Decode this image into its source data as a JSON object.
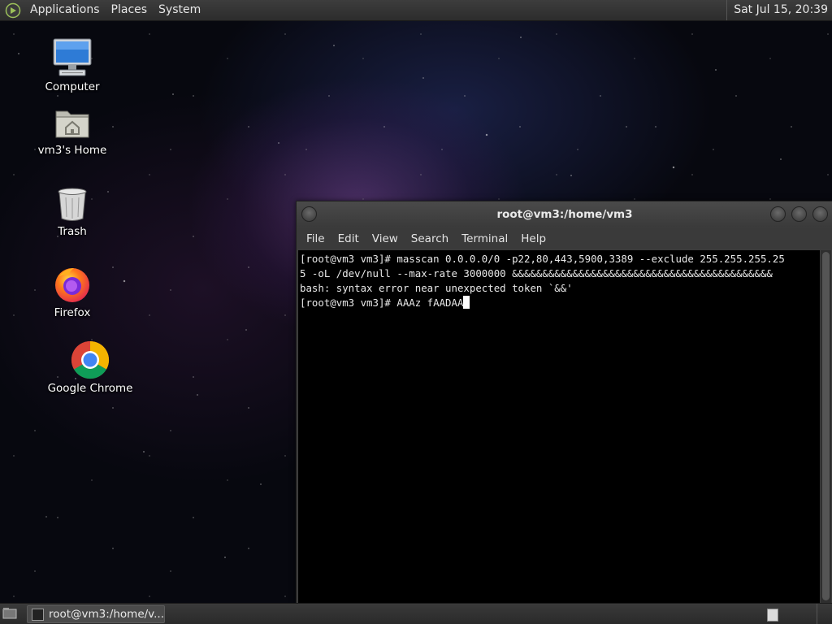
{
  "top_panel": {
    "menus": [
      "Applications",
      "Places",
      "System"
    ],
    "clock": "Sat Jul 15, 20:39"
  },
  "desktop_icons": [
    {
      "label": "Computer",
      "icon": "computer-icon"
    },
    {
      "label": "vm3's Home",
      "icon": "home-folder-icon"
    },
    {
      "label": "Trash",
      "icon": "trash-icon"
    },
    {
      "label": "Firefox",
      "icon": "firefox-icon"
    },
    {
      "label": "Google Chrome",
      "icon": "chrome-icon"
    }
  ],
  "terminal": {
    "title": "root@vm3:/home/vm3",
    "menu": [
      "File",
      "Edit",
      "View",
      "Search",
      "Terminal",
      "Help"
    ],
    "lines": [
      "[root@vm3 vm3]# masscan 0.0.0.0/0 -p22,80,443,5900,3389 --exclude 255.255.255.25",
      "5 -oL /dev/null --max-rate 3000000 &&&&&&&&&&&&&&&&&&&&&&&&&&&&&&&&&&&&&&&&&&&",
      "bash: syntax error near unexpected token `&&'",
      "[root@vm3 vm3]# AAAz fAADAA"
    ],
    "background": "#000000",
    "foreground": "#e8e8e8"
  },
  "taskbar": {
    "task_label": "root@vm3:/home/v..."
  },
  "colors": {
    "panel": "#2f2f2f",
    "titlebar": "#424242"
  }
}
